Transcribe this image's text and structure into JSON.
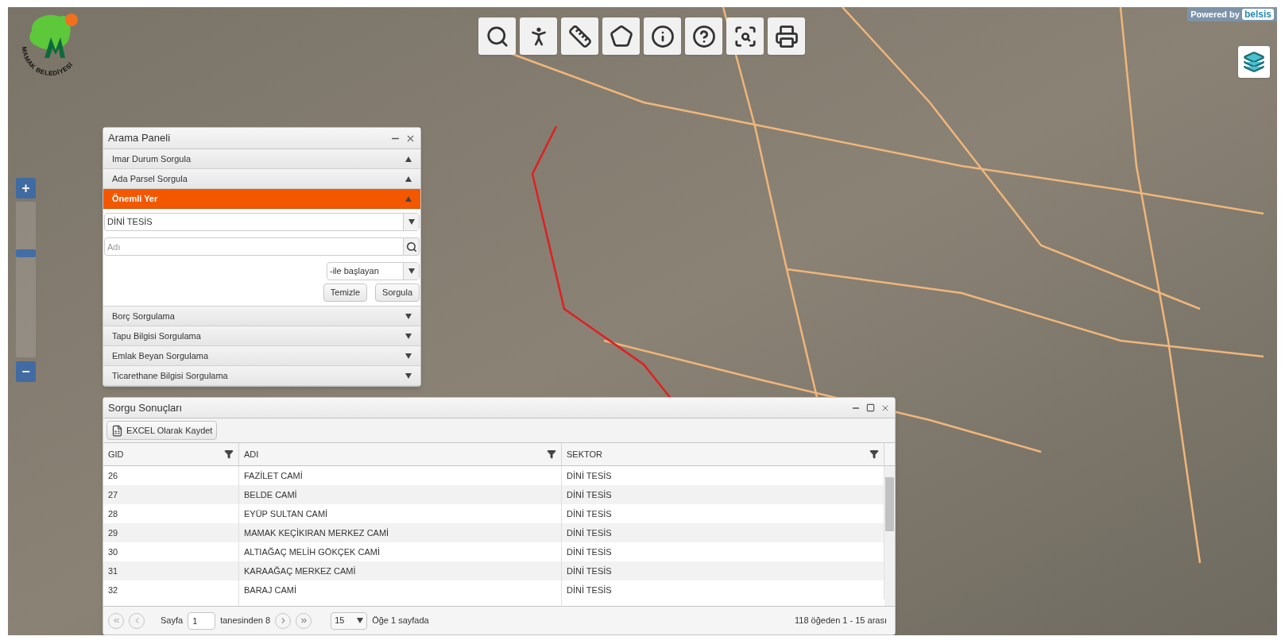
{
  "logo": {
    "text": "MAMAK BELEDİYESİ"
  },
  "powered_by": {
    "label": "Powered by",
    "brand": "belsis"
  },
  "zoom": {
    "plus": "+",
    "minus": "−",
    "level": 0.68
  },
  "search_panel": {
    "title": "Arama Paneli",
    "sections": [
      {
        "label": "Imar Durum Sorgula",
        "selected": false,
        "arrow_up": true
      },
      {
        "label": "Ada Parsel Sorgula",
        "selected": false,
        "arrow_up": true
      },
      {
        "label": "Önemli Yer",
        "selected": true,
        "arrow_up": true,
        "category": "DİNİ TESİS",
        "name_placeholder": "Adı",
        "match": "-ile başlayan",
        "buttons": [
          "Temizle",
          "Sorgula"
        ]
      },
      {
        "label": "Borç Sorgulama",
        "selected": false,
        "arrow_up": false
      },
      {
        "label": "Tapu Bilgisi Sorgulama",
        "selected": false,
        "arrow_up": false
      },
      {
        "label": "Emlak Beyan Sorgulama",
        "selected": false,
        "arrow_up": false
      },
      {
        "label": "Ticarethane Bilgisi Sorgulama",
        "selected": false,
        "arrow_up": false
      }
    ]
  },
  "results": {
    "title": "Sorgu Sonuçları",
    "export_button": "EXCEL Olarak Kaydet",
    "columns": [
      "GID",
      "ADI",
      "SEKTOR"
    ],
    "rows": [
      [
        "26",
        "FAZİLET CAMİ",
        "DİNİ TESİS"
      ],
      [
        "27",
        "BELDE CAMİ",
        "DİNİ TESİS"
      ],
      [
        "28",
        "EYÜP SULTAN CAMİ",
        "DİNİ TESİS"
      ],
      [
        "29",
        "MAMAK KEÇİKIRAN MERKEZ CAMİ",
        "DİNİ TESİS"
      ],
      [
        "30",
        "ALTIAĞAÇ MELİH GÖKÇEK CAMİ",
        "DİNİ TESİS"
      ],
      [
        "31",
        "KARAAĞAÇ MERKEZ CAMİ",
        "DİNİ TESİS"
      ],
      [
        "32",
        "BARAJ CAMİ",
        "DİNİ TESİS"
      ]
    ],
    "pager": {
      "page_label": "Sayfa",
      "page": "1",
      "of_pages": "tanesinden 8",
      "page_size": "15",
      "page_size_label": "Öğe 1 sayfada",
      "summary": "118 öğeden 1 - 15 arası"
    }
  }
}
